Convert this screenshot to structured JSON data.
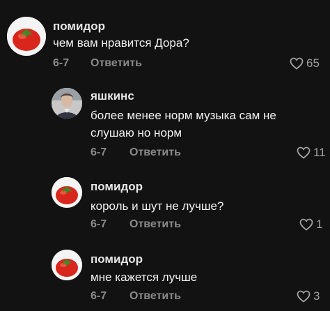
{
  "comments": [
    {
      "username": "помидор",
      "text_lines": [
        "чем вам нравится Дора?"
      ],
      "date": "6-7",
      "reply_label": "Ответить",
      "likes": "65",
      "avatar_icon": "tomato-avatar"
    },
    {
      "username": "яшкинс",
      "text_lines": [
        "более менее норм музыка сам не",
        "слушаю но норм"
      ],
      "date": "6-7",
      "reply_label": "Ответить",
      "likes": "11",
      "avatar_icon": "person-avatar"
    },
    {
      "username": "помидор",
      "text_lines": [
        "король и шут не лучше?"
      ],
      "date": "6-7",
      "reply_label": "Ответить",
      "likes": "1",
      "avatar_icon": "tomato-avatar"
    },
    {
      "username": "помидор",
      "text_lines": [
        "мне кажется лучше"
      ],
      "date": "6-7",
      "reply_label": "Ответить",
      "likes": "3",
      "avatar_icon": "tomato-avatar"
    }
  ],
  "colors": {
    "background": "#121212",
    "muted": "#8a8a8a",
    "text": "#f2f2f2"
  }
}
